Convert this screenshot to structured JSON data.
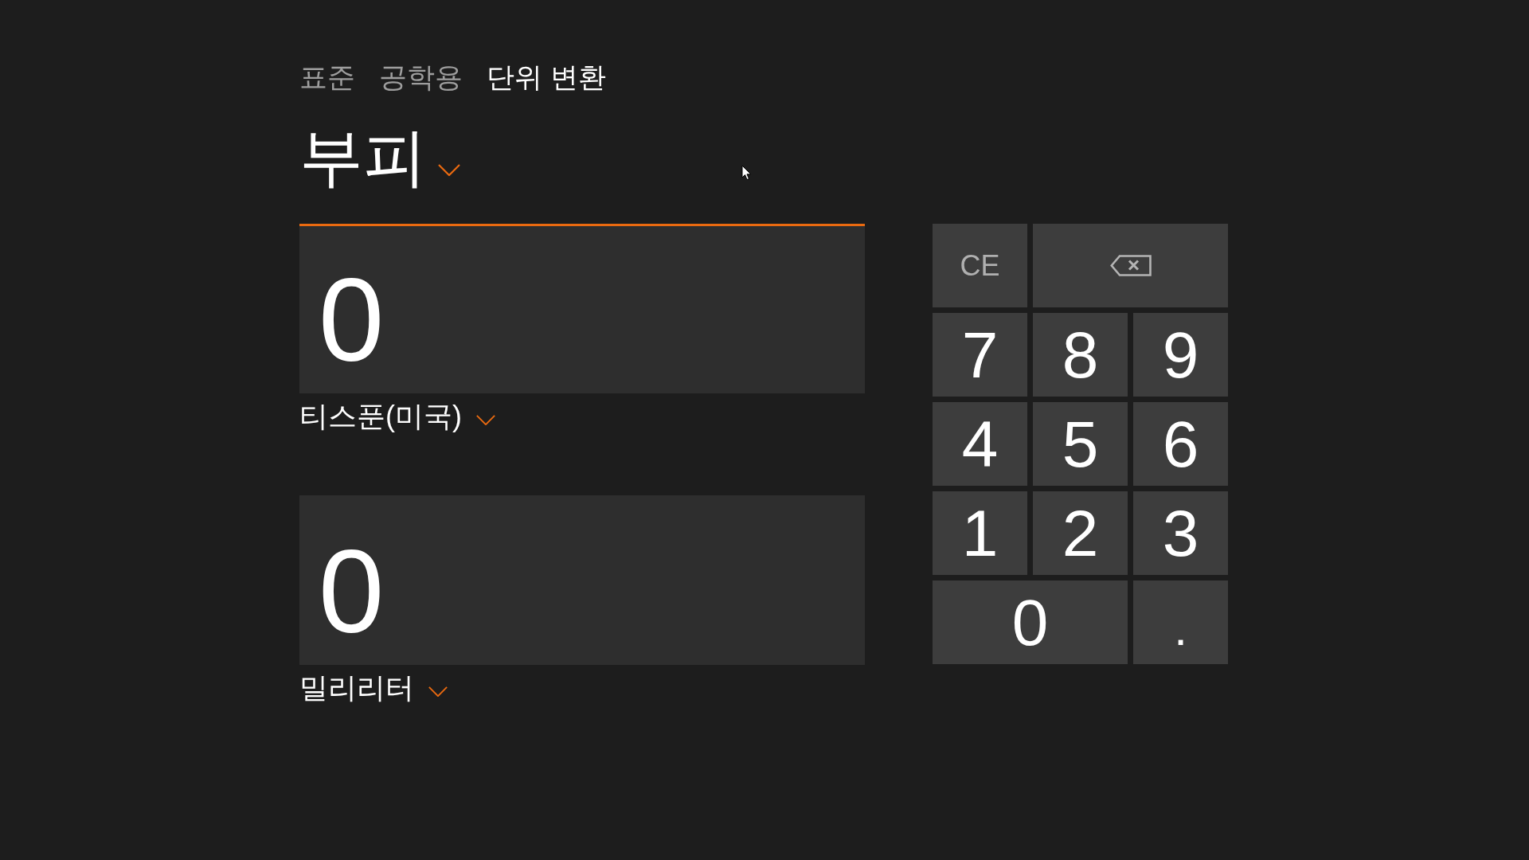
{
  "tabs": [
    {
      "label": "표준",
      "selected": false
    },
    {
      "label": "공학용",
      "selected": false
    },
    {
      "label": "단위 변환",
      "selected": true
    }
  ],
  "category": {
    "label": "부피"
  },
  "converters": [
    {
      "value": "0",
      "unit": "티스푼(미국)",
      "focused": true
    },
    {
      "value": "0",
      "unit": "밀리리터",
      "focused": false
    }
  ],
  "keypad": [
    {
      "kind": "clear",
      "label": "CE",
      "wide": false
    },
    {
      "kind": "backspace",
      "wide": true
    },
    {
      "kind": "digit",
      "label": "7",
      "wide": false
    },
    {
      "kind": "digit",
      "label": "8",
      "wide": false
    },
    {
      "kind": "digit",
      "label": "9",
      "wide": false
    },
    {
      "kind": "digit",
      "label": "4",
      "wide": false
    },
    {
      "kind": "digit",
      "label": "5",
      "wide": false
    },
    {
      "kind": "digit",
      "label": "6",
      "wide": false
    },
    {
      "kind": "digit",
      "label": "1",
      "wide": false
    },
    {
      "kind": "digit",
      "label": "2",
      "wide": false
    },
    {
      "kind": "digit",
      "label": "3",
      "wide": false
    },
    {
      "kind": "digit",
      "label": "0",
      "wide": true
    },
    {
      "kind": "point",
      "label": ".",
      "wide": false
    }
  ]
}
